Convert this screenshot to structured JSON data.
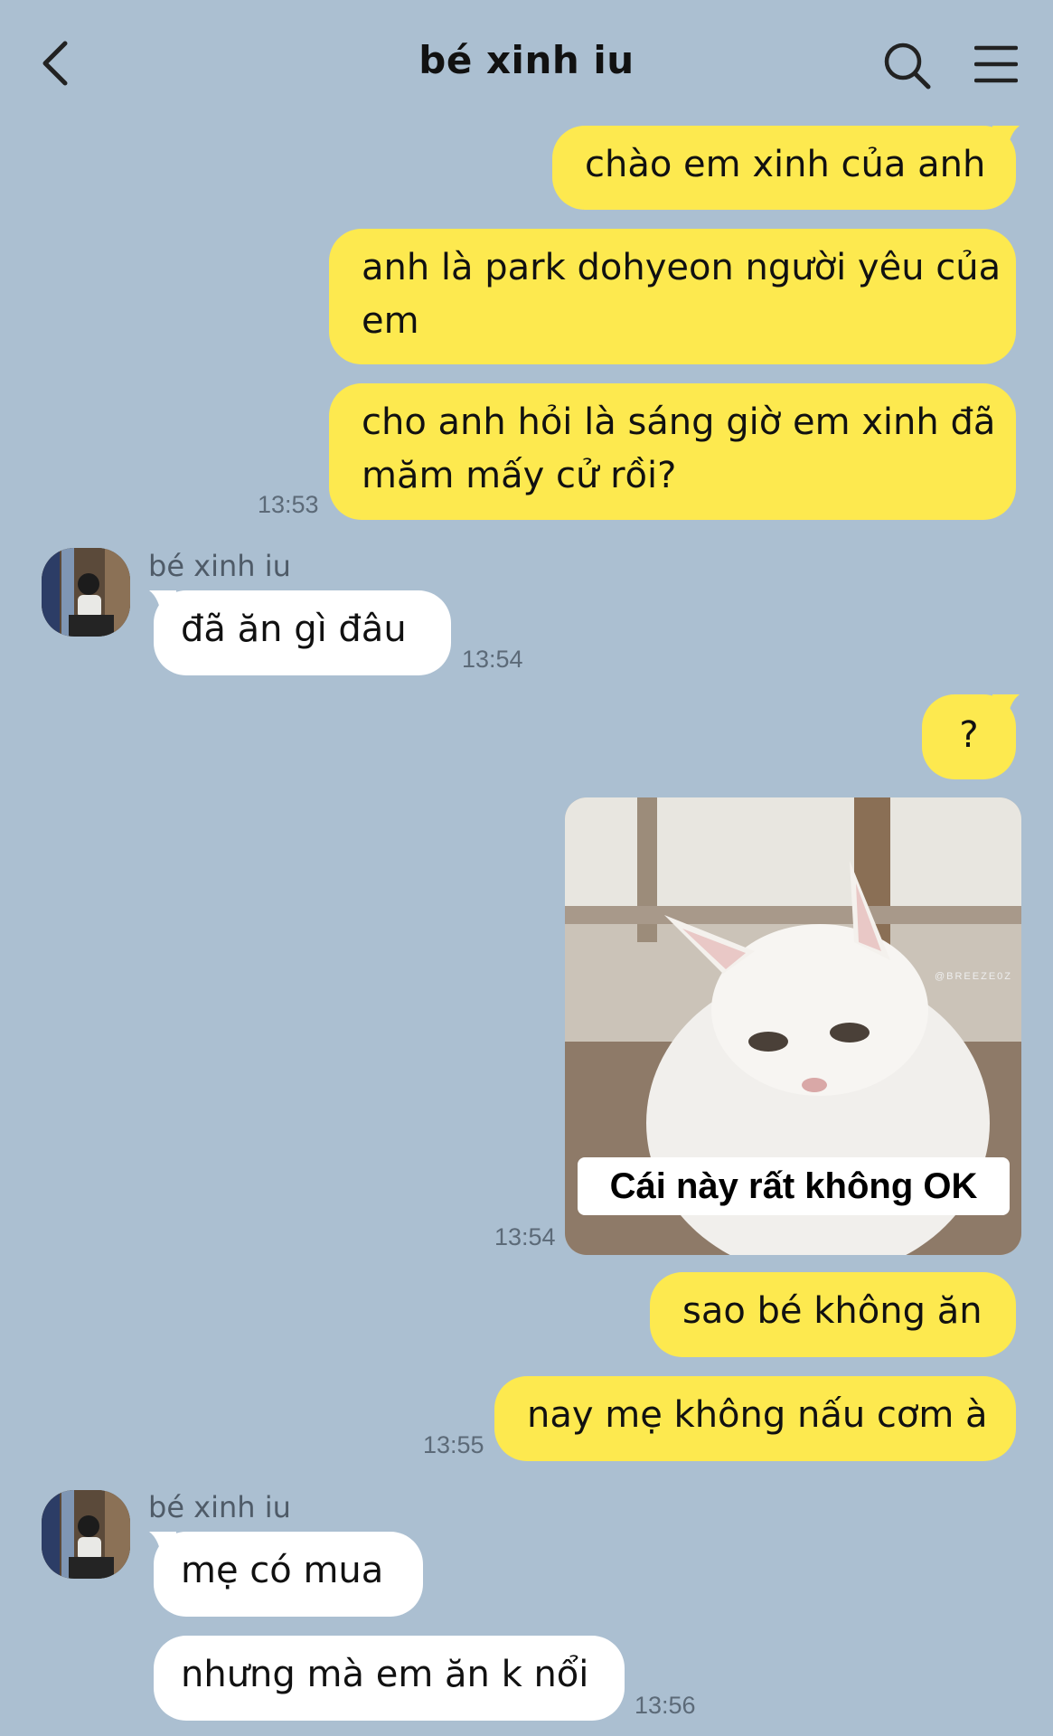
{
  "header": {
    "title": "bé xinh iu",
    "back_icon": "chevron-left-icon",
    "search_icon": "search-icon",
    "menu_icon": "hamburger-menu-icon"
  },
  "messages": {
    "m1": "chào em xinh của anh",
    "m2_line1": "anh là park dohyeon người yêu của",
    "m2_line2": "em",
    "m3_line1": "cho anh hỏi là sáng giờ em xinh đã",
    "m3_line2": "măm mấy cử rồi?",
    "t1": "13:53",
    "sender1": "bé xinh iu",
    "m4": "đã ăn gì đâu",
    "t2": "13:54",
    "m5": "?",
    "sticker_caption": "Cái này rất không OK",
    "sticker_watermark": "@BREEZE0Z",
    "t3": "13:54",
    "m6": "sao bé không ăn",
    "m7": "nay mẹ không nấu cơm à",
    "t4": "13:55",
    "sender2": "bé xinh iu",
    "m8": "mẹ có mua",
    "m9": "nhưng mà em ăn k nổi",
    "t5": "13:56"
  },
  "colors": {
    "background": "#abbfd1",
    "outgoing_bubble": "#fde94f",
    "incoming_bubble": "#ffffff"
  }
}
